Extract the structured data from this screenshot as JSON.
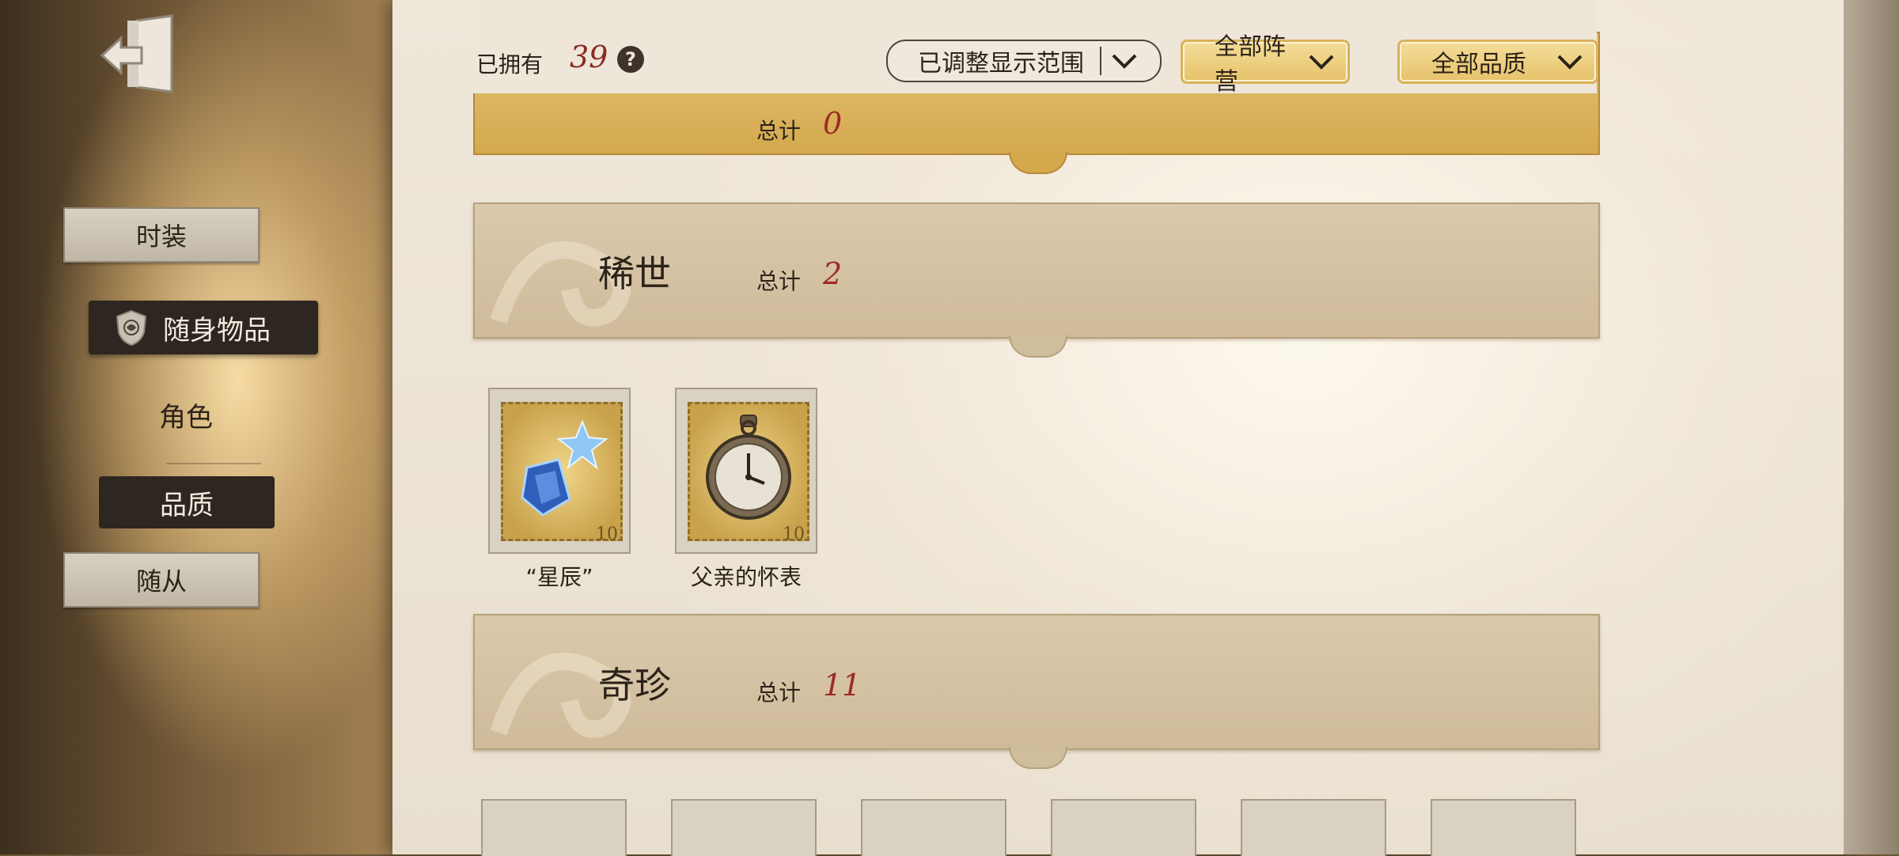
{
  "header": {
    "owned_label": "已拥有",
    "owned_count": "39",
    "help": "?",
    "range_dropdown": "已调整显示范围",
    "faction_dropdown": "全部阵营",
    "quality_dropdown": "全部品质"
  },
  "nav": {
    "fashion": "时装",
    "items": "随身物品",
    "character": "角色",
    "quality": "品质",
    "follower": "随从"
  },
  "sections": [
    {
      "title": "",
      "total_label": "总计",
      "total": "0"
    },
    {
      "title": "稀世",
      "total_label": "总计",
      "total": "2"
    },
    {
      "title": "奇珍",
      "total_label": "总计",
      "total": "11"
    }
  ],
  "items": [
    {
      "name": "“星辰”",
      "stamp": "10",
      "icon": "star-crystal-icon"
    },
    {
      "name": "父亲的怀表",
      "stamp": "10",
      "icon": "pocket-watch-icon"
    }
  ],
  "colors": {
    "accent_red": "#9b2b24",
    "gold": "#d4a94e",
    "dark_plate": "#2d2621"
  }
}
